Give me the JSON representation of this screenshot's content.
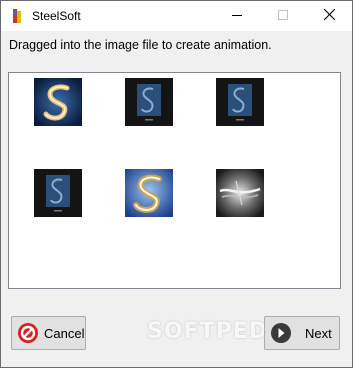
{
  "window": {
    "title": "SteelSoft"
  },
  "instruction": "Dragged into the image file to create animation.",
  "thumbnails": [
    {
      "label": "thumb-1",
      "style": "s-logo-dark"
    },
    {
      "label": "thumb-2",
      "style": "dark-frame"
    },
    {
      "label": "thumb-3",
      "style": "dark-frame"
    },
    {
      "label": "thumb-4",
      "style": "dark-frame"
    },
    {
      "label": "thumb-5",
      "style": "s-logo-blue"
    },
    {
      "label": "thumb-6",
      "style": "grayscale"
    }
  ],
  "buttons": {
    "cancel": "Cancel",
    "next": "Next"
  },
  "watermark": "SOFTPEDIA",
  "colors": {
    "cancel_icon": "#d81e1e",
    "next_icon": "#3a3a3a"
  }
}
